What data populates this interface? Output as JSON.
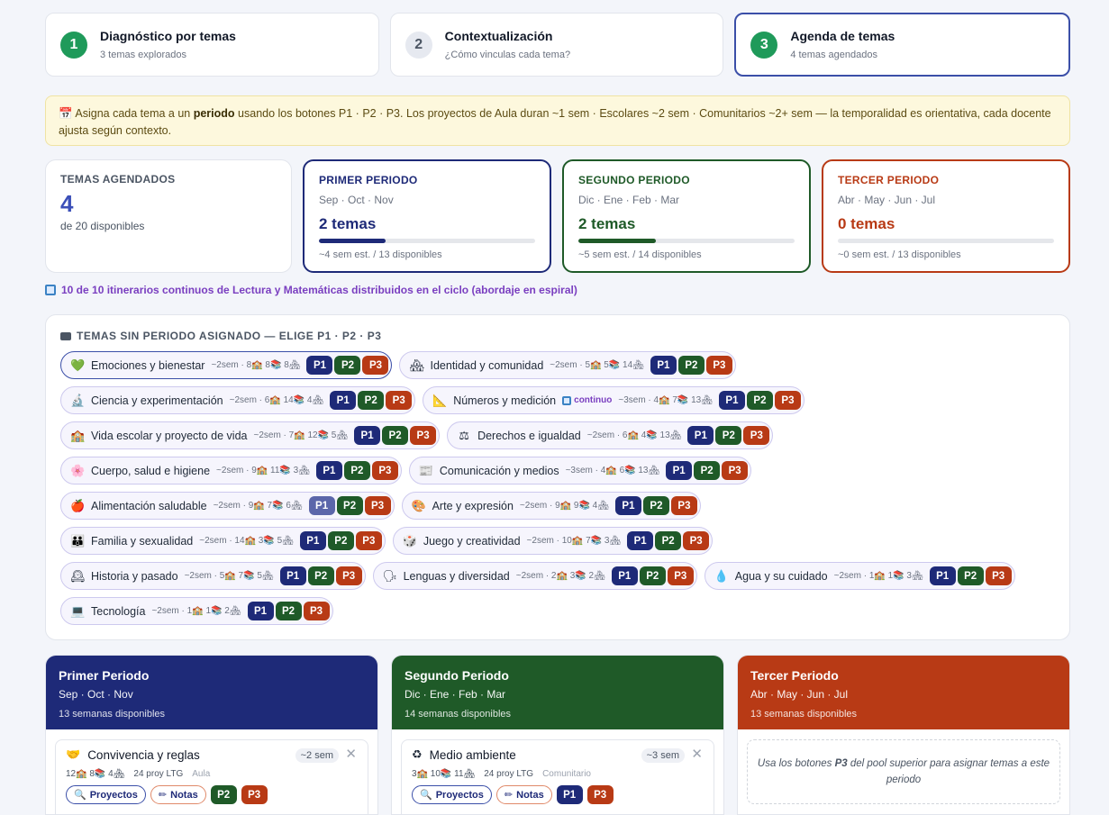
{
  "steps": [
    {
      "num": "1",
      "title": "Diagnóstico por temas",
      "sub": "3 temas explorados"
    },
    {
      "num": "2",
      "title": "Contextualización",
      "sub": "¿Cómo vinculas cada tema?"
    },
    {
      "num": "3",
      "title": "Agenda de temas",
      "sub": "4 temas agendados"
    }
  ],
  "banner": {
    "icon": "calendar-icon",
    "pre": "Asigna cada tema a un ",
    "bold": "periodo",
    "post": " usando los botones P1 · P2 · P3. Los proyectos de Aula duran ~1 sem · Escolares ~2 sem · Comunitarios ~2+ sem — la temporalidad es orientativa, cada docente ajusta según contexto."
  },
  "stats": {
    "total": {
      "label": "TEMAS AGENDADOS",
      "value": "4",
      "sub": "de 20 disponibles"
    },
    "periods": [
      {
        "label": "PRIMER PERIODO",
        "months": "Sep · Oct · Nov",
        "count": "2 temas",
        "foot": "~4 sem est. / 13 disponibles",
        "progress": 0.31,
        "color": "#1e2a78"
      },
      {
        "label": "SEGUNDO PERIODO",
        "months": "Dic · Ene · Feb · Mar",
        "count": "2 temas",
        "foot": "~5 sem est. / 14 disponibles",
        "progress": 0.36,
        "color": "#1f5a28"
      },
      {
        "label": "TERCER PERIODO",
        "months": "Abr · May · Jun · Jul",
        "count": "0 temas",
        "foot": "~0 sem est. / 13 disponibles",
        "progress": 0,
        "color": "#b83a15"
      }
    ]
  },
  "spiral": "10 de 10 itinerarios continuos de Lectura y Matemáticas distribuidos en el ciclo (abordaje en espiral)",
  "pool": {
    "title": "TEMAS SIN PERIODO ASIGNADO — ELIGE P1 · P2 · P3",
    "buttons": [
      "P1",
      "P2",
      "P3"
    ],
    "rows": [
      [
        {
          "emoji": "💚",
          "icon": "green-heart-icon",
          "name": "Emociones y bienestar",
          "meta": "~2sem · 8🏫 8📚 8🏘",
          "selected": true
        },
        {
          "emoji": "🏘",
          "icon": "houses-icon",
          "name": "Identidad y comunidad",
          "meta": "~2sem · 5🏫 5📚 14🏘"
        }
      ],
      [
        {
          "emoji": "🔬",
          "icon": "microscope-icon",
          "name": "Ciencia y experimentación",
          "meta": "~2sem · 6🏫 14📚 4🏘"
        },
        {
          "emoji": "📐",
          "icon": "triangle-ruler-icon",
          "name": "Números y medición",
          "cont": "continuo",
          "meta": "~3sem · 4🏫 7📚 13🏘"
        }
      ],
      [
        {
          "emoji": "🏫",
          "icon": "school-icon",
          "name": "Vida escolar y proyecto de vida",
          "meta": "~2sem · 7🏫 12📚 5🏘"
        },
        {
          "emoji": "⚖",
          "icon": "scales-icon",
          "name": "Derechos e igualdad",
          "meta": "~2sem · 6🏫 4📚 13🏘"
        }
      ],
      [
        {
          "emoji": "🌸",
          "icon": "flower-icon",
          "name": "Cuerpo, salud e higiene",
          "meta": "~2sem · 9🏫 11📚 3🏘"
        },
        {
          "emoji": "📰",
          "icon": "newspaper-icon",
          "name": "Comunicación y medios",
          "meta": "~3sem · 4🏫 6📚 13🏘"
        }
      ],
      [
        {
          "emoji": "🍎",
          "icon": "apple-icon",
          "name": "Alimentación saludable",
          "meta": "~2sem · 9🏫 7📚 6🏘",
          "p1dim": true
        },
        {
          "emoji": "🎨",
          "icon": "palette-icon",
          "name": "Arte y expresión",
          "meta": "~2sem · 9🏫 9📚 4🏘"
        }
      ],
      [
        {
          "emoji": "👪",
          "icon": "family-icon",
          "name": "Familia y sexualidad",
          "meta": "~2sem · 14🏫 3📚 5🏘"
        },
        {
          "emoji": "🎲",
          "icon": "dice-icon",
          "name": "Juego y creatividad",
          "meta": "~2sem · 10🏫 7📚 3🏘"
        }
      ],
      [
        {
          "emoji": "🕰",
          "icon": "clock-icon",
          "name": "Historia y pasado",
          "meta": "~2sem · 5🏫 7📚 5🏘"
        },
        {
          "emoji": "🗣",
          "icon": "speaking-head-icon",
          "name": "Lenguas y diversidad",
          "meta": "~2sem · 2🏫 3📚 2🏘"
        },
        {
          "emoji": "💧",
          "icon": "droplet-icon",
          "name": "Agua y su cuidado",
          "meta": "~2sem · 1🏫 1📚 3🏘"
        }
      ],
      [
        {
          "emoji": "💻",
          "icon": "laptop-icon",
          "name": "Tecnología",
          "meta": "~2sem · 1🏫 1📚 2🏘"
        }
      ]
    ]
  },
  "columns": [
    {
      "title": "Primer Periodo",
      "months": "Sep · Oct · Nov",
      "weeks": "13 semanas disponibles",
      "card": {
        "emoji": "🤝",
        "icon": "handshake-icon",
        "name": "Convivencia y reglas",
        "sem": "~2 sem",
        "counts": "12🏫 8📚 4🏘",
        "proy": "24 proy LTG",
        "type": "Aula",
        "btns": [
          "P2",
          "P3"
        ]
      }
    },
    {
      "title": "Segundo Periodo",
      "months": "Dic · Ene · Feb · Mar",
      "weeks": "14 semanas disponibles",
      "card": {
        "emoji": "♻",
        "icon": "recycle-icon",
        "name": "Medio ambiente",
        "sem": "~3 sem",
        "counts": "3🏫 10📚 11🏘",
        "proy": "24 proy LTG",
        "type": "Comunitario",
        "btns": [
          "P1",
          "P3"
        ]
      }
    },
    {
      "title": "Tercer Periodo",
      "months": "Abr · May · Jun · Jul",
      "weeks": "13 semanas disponibles",
      "empty_pre": "Usa los botones ",
      "empty_bold": "P3",
      "empty_post": " del pool superior para asignar temas a este periodo"
    }
  ],
  "card_actions": {
    "projects": "Proyectos",
    "notes": "Notas",
    "close": "✕"
  }
}
